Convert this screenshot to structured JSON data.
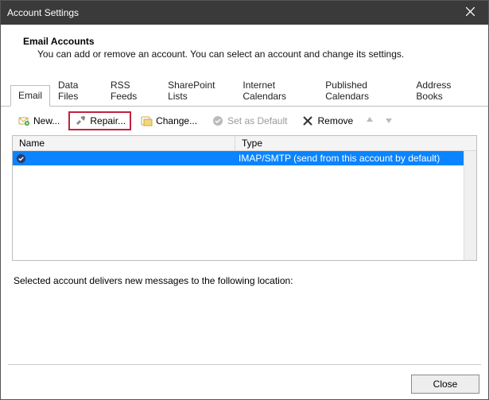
{
  "window": {
    "title": "Account Settings"
  },
  "header": {
    "title": "Email Accounts",
    "subtitle": "You can add or remove an account. You can select an account and change its settings."
  },
  "tabs": [
    {
      "label": "Email",
      "active": true
    },
    {
      "label": "Data Files"
    },
    {
      "label": "RSS Feeds"
    },
    {
      "label": "SharePoint Lists"
    },
    {
      "label": "Internet Calendars"
    },
    {
      "label": "Published Calendars"
    },
    {
      "label": "Address Books"
    }
  ],
  "toolbar": {
    "new_label": "New...",
    "repair_label": "Repair...",
    "change_label": "Change...",
    "default_label": "Set as Default",
    "remove_label": "Remove"
  },
  "list": {
    "columns": {
      "name": "Name",
      "type": "Type"
    },
    "rows": [
      {
        "name": "",
        "type": "IMAP/SMTP (send from this account by default)",
        "selected": true,
        "default": true
      }
    ]
  },
  "selected_msg": "Selected account delivers new messages to the following location:",
  "footer": {
    "close_label": "Close"
  }
}
